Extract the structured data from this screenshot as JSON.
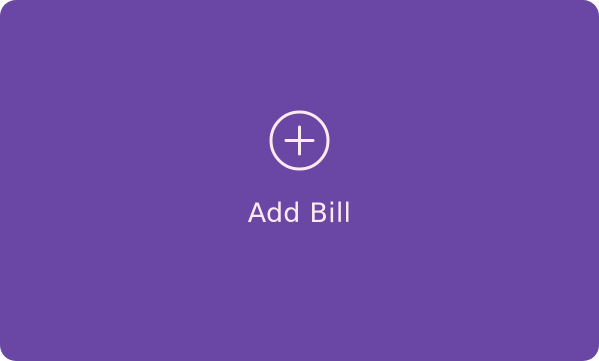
{
  "add_bill_card": {
    "label": "Add Bill",
    "icon": "plus-circle-icon"
  },
  "colors": {
    "card_background": "#6a46a5",
    "foreground": "#fbeaef"
  }
}
